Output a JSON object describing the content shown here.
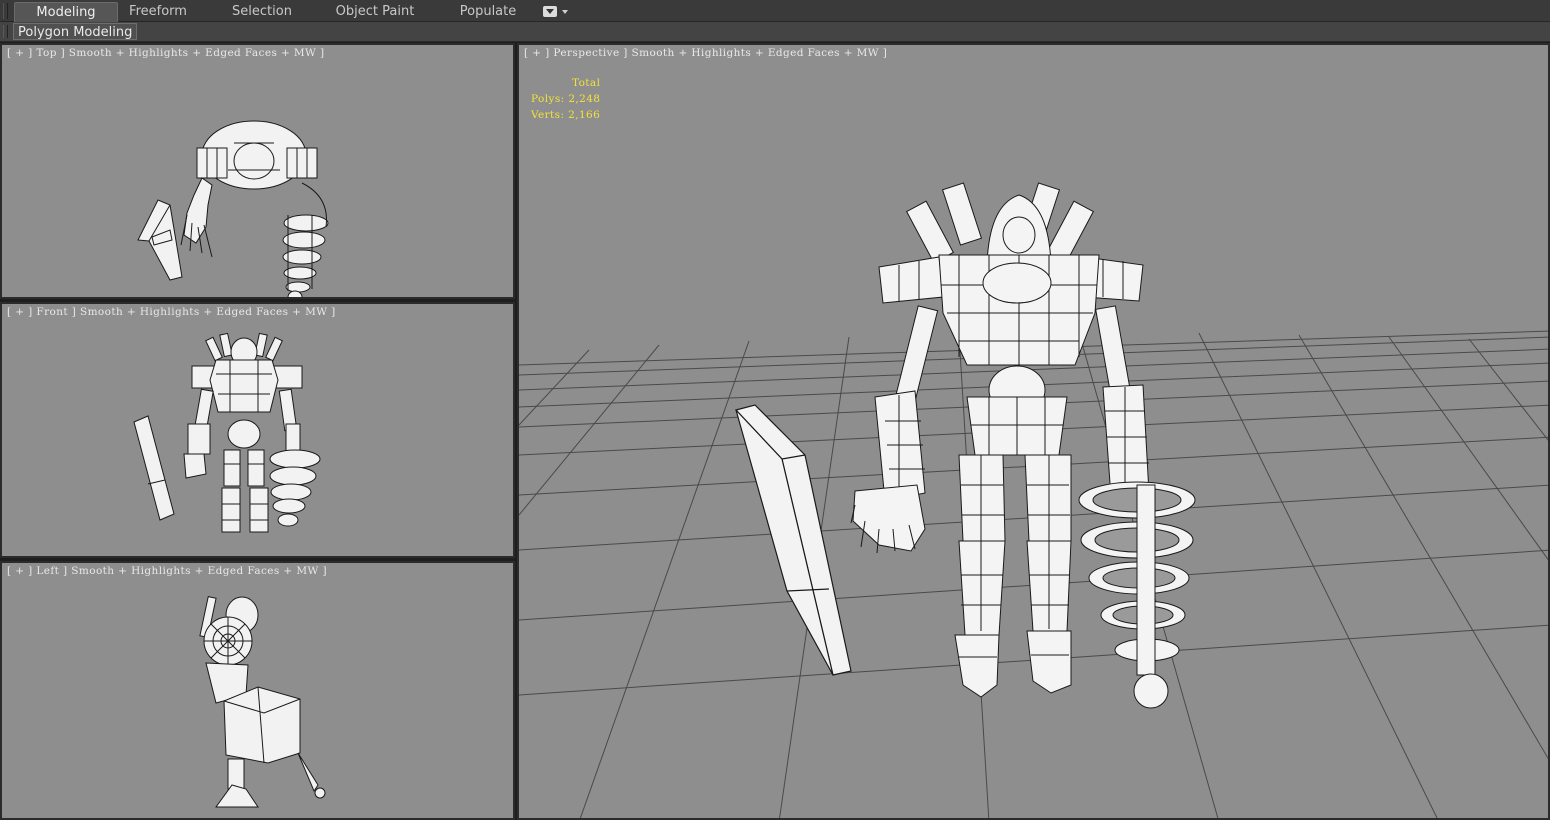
{
  "ribbon": {
    "tabs": [
      {
        "label": "Modeling",
        "active": true
      },
      {
        "label": "Freeform",
        "active": false
      },
      {
        "label": "Selection",
        "active": false
      },
      {
        "label": "Object Paint",
        "active": false
      },
      {
        "label": "Populate",
        "active": false
      }
    ],
    "panel_button": "Polygon Modeling"
  },
  "viewports": {
    "top": {
      "label": "[ + ] Top ] Smooth + Highlights + Edged Faces + MW ]"
    },
    "front": {
      "label": "[ + ] Front ] Smooth + Highlights + Edged Faces + MW ]"
    },
    "left": {
      "label": "[ + ] Left ] Smooth + Highlights + Edged Faces + MW ]"
    },
    "perspective": {
      "label": "[ + ] Perspective ] Smooth + Highlights + Edged Faces + MW ]",
      "stats": {
        "header": "Total",
        "polys_label": "Polys:",
        "polys_value": "2,248",
        "verts_label": "Verts:",
        "verts_value": "2,166"
      }
    }
  },
  "colors": {
    "viewport_bg": "#8e8e8e",
    "stats_text": "#f2e23a",
    "mesh_fill": "#f4f4f4",
    "wire": "#1a1a1a"
  }
}
